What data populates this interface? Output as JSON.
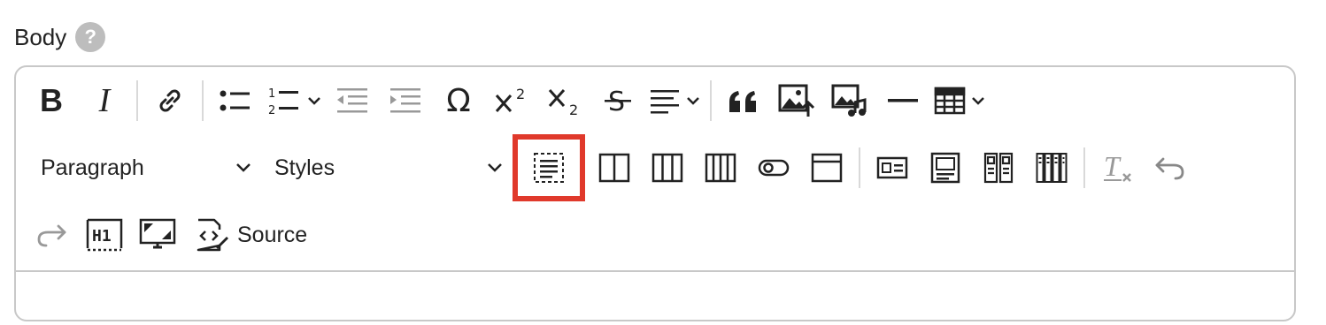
{
  "field": {
    "label": "Body",
    "help_glyph": "?"
  },
  "toolbar": {
    "bold_glyph": "B",
    "italic_glyph": "I",
    "special_char_glyph": "Ω",
    "paragraph_dropdown": "Paragraph",
    "styles_dropdown": "Styles",
    "source_label": "Source",
    "icons": [
      "bold-icon",
      "italic-icon",
      "link-icon",
      "bulleted-list-icon",
      "numbered-list-icon",
      "outdent-icon",
      "indent-icon",
      "special-characters-icon",
      "superscript-icon",
      "subscript-icon",
      "strikethrough-icon",
      "align-icon",
      "blockquote-icon",
      "insert-image-icon",
      "insert-media-icon",
      "horizontal-line-icon",
      "table-icon",
      "single-column-layout-icon",
      "two-column-layout-icon",
      "three-column-layout-icon",
      "four-column-layout-icon",
      "toggle-icon",
      "header-block-icon",
      "card-icon",
      "hero-block-icon",
      "two-cards-icon",
      "four-cards-icon",
      "remove-format-icon",
      "undo-icon",
      "redo-icon",
      "heading-h1-icon",
      "fullscreen-icon",
      "source-icon"
    ],
    "highlight_color": "#e0392b"
  }
}
